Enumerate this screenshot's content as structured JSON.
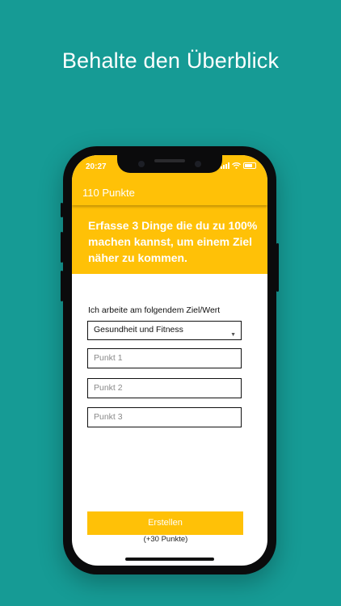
{
  "headline": "Behalte den Überblick",
  "status_bar": {
    "time": "20:27"
  },
  "app_bar": {
    "points": "110 Punkte"
  },
  "banner": {
    "text": "Erfasse 3 Dinge die du zu 100% machen kannst, um einem Ziel näher zu kommen."
  },
  "form": {
    "goal_label": "Ich arbeite am folgendem Ziel/Wert",
    "goal_select": {
      "value": "Gesundheit und Fitness"
    },
    "fields": [
      {
        "placeholder": "Punkt 1"
      },
      {
        "placeholder": "Punkt 2"
      },
      {
        "placeholder": "Punkt 3"
      }
    ],
    "submit_label": "Erstellen",
    "bonus_text": "(+30 Punkte)"
  },
  "colors": {
    "background": "#169b95",
    "accent": "#ffc107",
    "device": "#0b0b0c"
  }
}
